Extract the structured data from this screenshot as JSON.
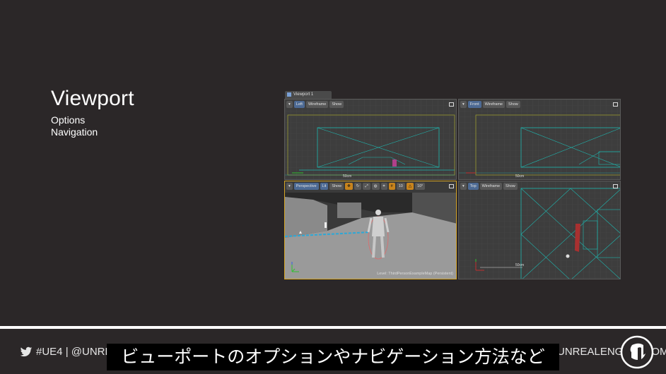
{
  "slide": {
    "title": "Viewport",
    "bullets": [
      "Options",
      "Navigation"
    ]
  },
  "editor": {
    "tab_label": "Viewport 1",
    "viewports": {
      "left": {
        "view": "Left",
        "mode": "Wireframe",
        "show": "Show",
        "scale_label": "50cm"
      },
      "front": {
        "view": "Front",
        "mode": "Wireframe",
        "show": "Show",
        "scale_label": "50cm"
      },
      "perspective": {
        "view": "Perspective",
        "mode": "Lit",
        "show": "Show",
        "grid_snap": "10",
        "rot_snap": "10°",
        "level_label": "Level: ThirdPersonExampleMap (Persistent)"
      },
      "top": {
        "view": "Top",
        "mode": "Wireframe",
        "show": "Show",
        "scale_label": "50cm"
      }
    }
  },
  "footer": {
    "handle": "#UE4 | @UNREALENGINE",
    "site": "UNREALENGINE.COM",
    "caption": "ビューポートのオプションやナビゲーション方法など"
  },
  "colors": {
    "background": "#2b2728",
    "wire_cyan": "#1fb7b0",
    "grid": "#4a4a4a",
    "active_border": "#d6a626"
  },
  "icons": [
    "twitter-icon",
    "unreal-logo-icon",
    "viewport-tab-icon",
    "maximize-icon"
  ]
}
